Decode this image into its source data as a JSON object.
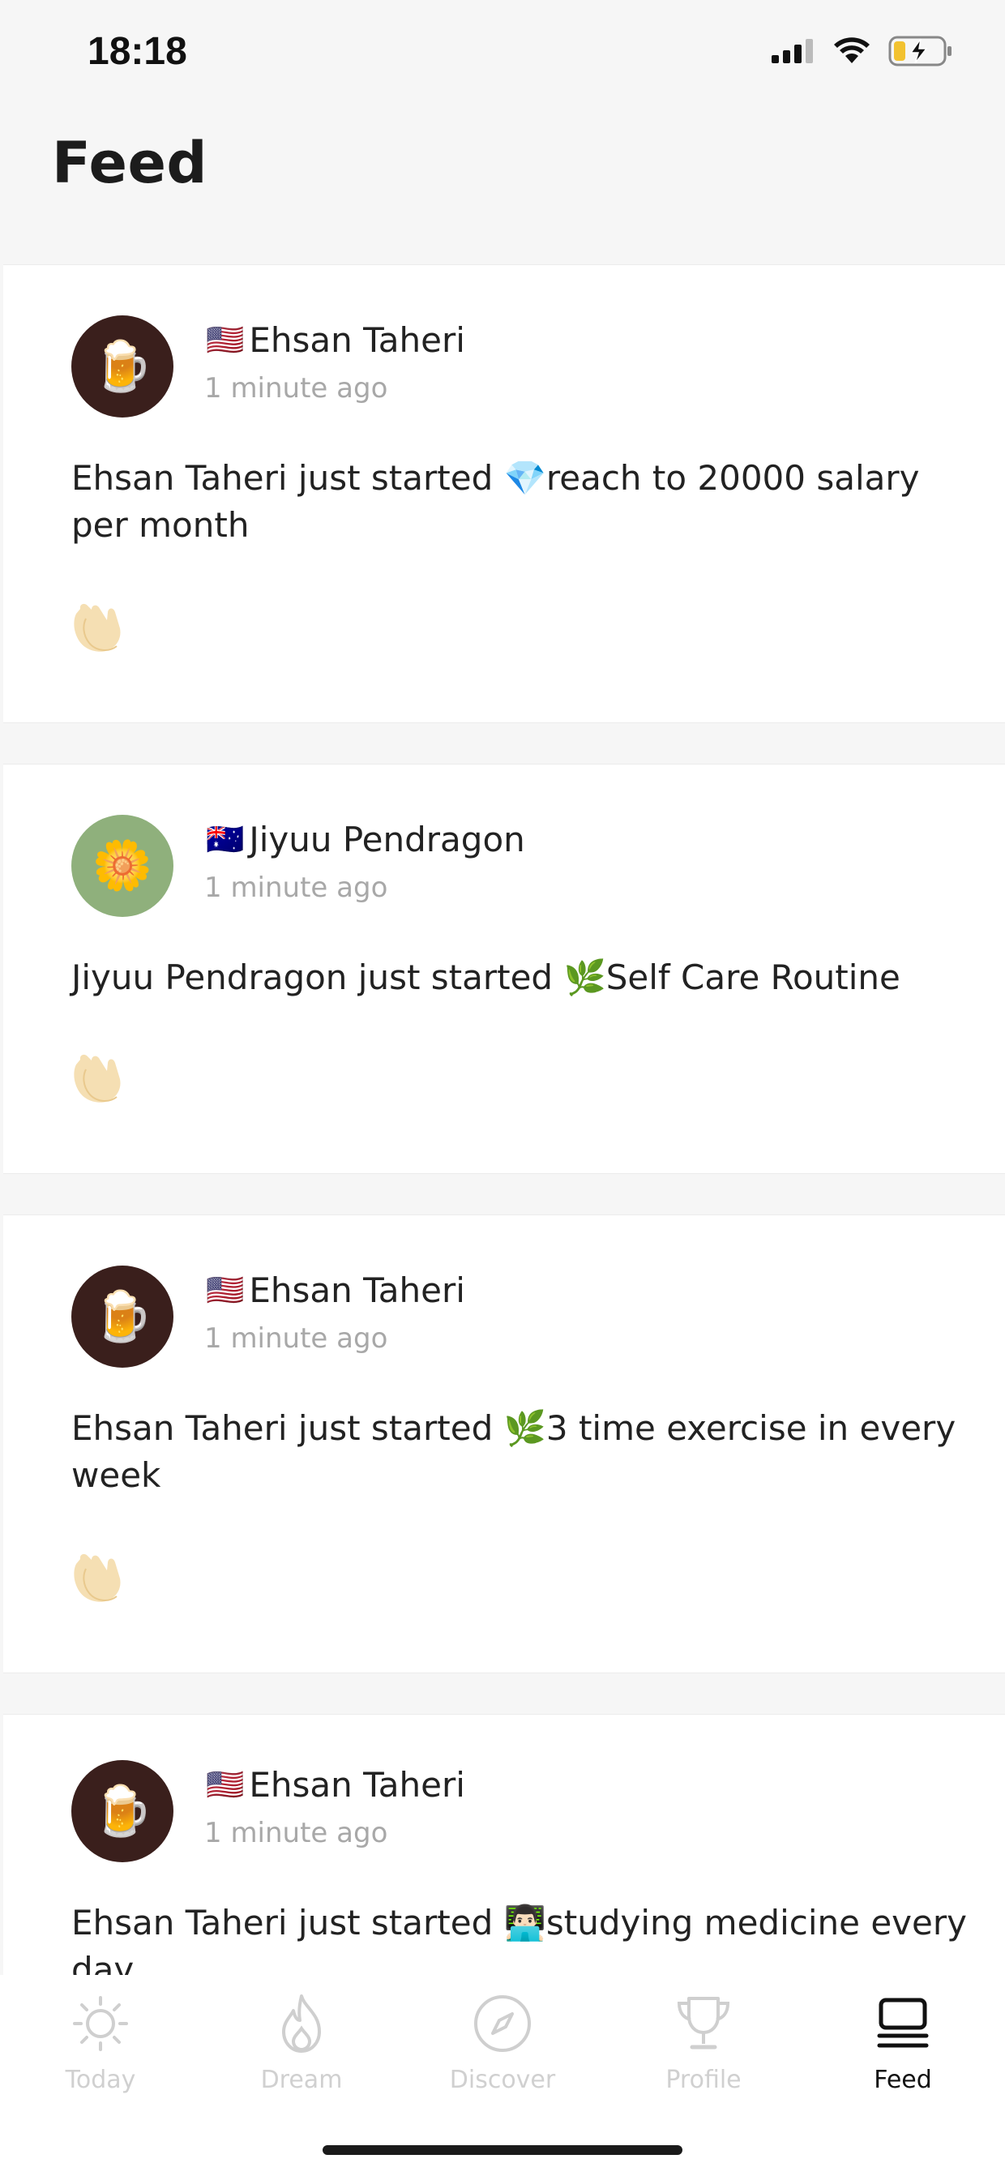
{
  "status_bar": {
    "time": "18:18"
  },
  "header": {
    "title": "Feed"
  },
  "feed": {
    "posts": [
      {
        "avatar_emoji": "🍺",
        "flag": "🇺🇸",
        "user": "Ehsan Taheri",
        "time": "1 minute ago",
        "text_prefix": "Ehsan Taheri just started ",
        "goal_emoji": "💎",
        "goal": "reach to 20000 salary per month"
      },
      {
        "avatar_emoji": "🌼",
        "flag": "🇦🇺",
        "user": "Jiyuu Pendragon",
        "time": "1 minute ago",
        "text_prefix": "Jiyuu Pendragon just started ",
        "goal_emoji": "🌿",
        "goal": "Self Care Routine"
      },
      {
        "avatar_emoji": "🍺",
        "flag": "🇺🇸",
        "user": "Ehsan Taheri",
        "time": "1 minute ago",
        "text_prefix": "Ehsan Taheri just started ",
        "goal_emoji": "🌿",
        "goal": "3 time exercise in every week"
      },
      {
        "avatar_emoji": "🍺",
        "flag": "🇺🇸",
        "user": "Ehsan Taheri",
        "time": "1 minute ago",
        "text_prefix": "Ehsan Taheri just started ",
        "goal_emoji": "👨🏻‍💻",
        "goal": "studying medicine every day"
      }
    ]
  },
  "tab_bar": {
    "tabs": [
      {
        "label": "Today",
        "icon": "sun-icon",
        "active": false
      },
      {
        "label": "Dream",
        "icon": "flame-icon",
        "active": false
      },
      {
        "label": "Discover",
        "icon": "compass-icon",
        "active": false
      },
      {
        "label": "Profile",
        "icon": "trophy-icon",
        "active": false
      },
      {
        "label": "Feed",
        "icon": "feed-stack-icon",
        "active": true
      }
    ]
  },
  "colors": {
    "background": "#f6f6f6",
    "card": "#ffffff",
    "inactive_tab": "#d0d0d0",
    "active_tab": "#111111",
    "timestamp": "#a8a8a8"
  }
}
